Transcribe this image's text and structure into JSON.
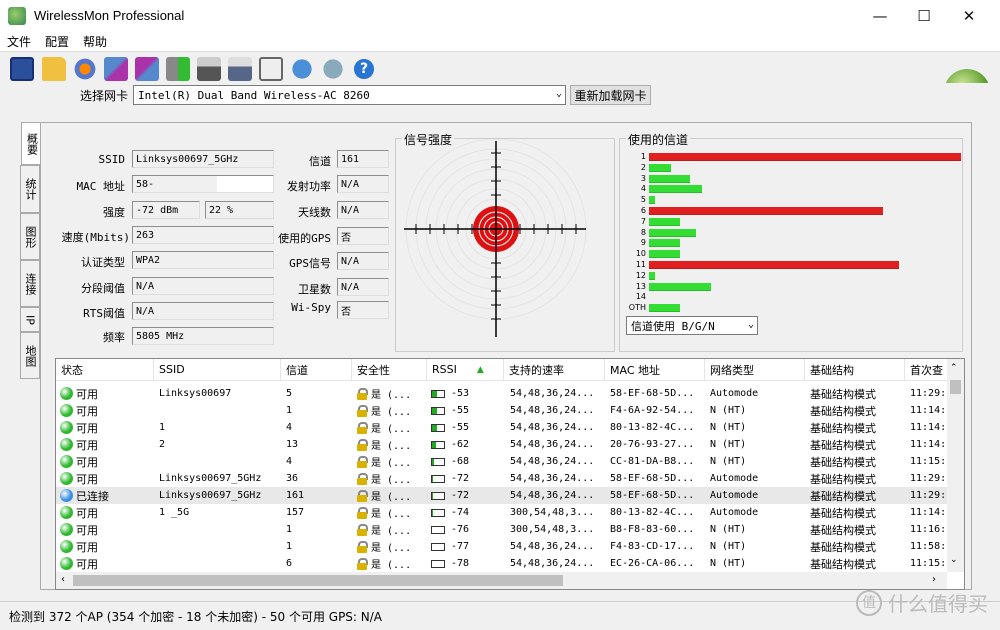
{
  "window": {
    "title": "WirelessMon Professional"
  },
  "menu": [
    "文件",
    "配置",
    "帮助"
  ],
  "toolbar_icons": [
    "save-icon",
    "open-folder-icon",
    "record-icon",
    "network-icon",
    "network-alt-icon",
    "play-icon",
    "print-icon",
    "printer-check-icon",
    "clipboard-icon",
    "globe-icon",
    "chat-icon",
    "help-icon"
  ],
  "nic": {
    "label": "选择网卡",
    "value": "Intel(R) Dual Band Wireless-AC 8260",
    "reload": "重新加载网卡"
  },
  "tabs": [
    "概要",
    "统计",
    "图形",
    "连接",
    "IP",
    "地图"
  ],
  "summary": {
    "ssid": {
      "label": "SSID",
      "value": "Linksys00697_5GHz"
    },
    "mac": {
      "label": "MAC 地址",
      "value": "58-"
    },
    "strength": {
      "label": "强度",
      "value": "-72 dBm",
      "pct": "22 %"
    },
    "speed": {
      "label": "速度(Mbits)",
      "value": "263"
    },
    "auth": {
      "label": "认证类型",
      "value": "WPA2"
    },
    "frag": {
      "label": "分段阈值",
      "value": "N/A"
    },
    "rts": {
      "label": "RTS阈值",
      "value": "N/A"
    },
    "freq": {
      "label": "频率",
      "value": "5805 MHz"
    },
    "channel": {
      "label": "信道",
      "value": "161"
    },
    "txpower": {
      "label": "发射功率",
      "value": "N/A"
    },
    "antenna": {
      "label": "天线数",
      "value": "N/A"
    },
    "gps_used": {
      "label": "使用的GPS",
      "value": "否"
    },
    "gps_signal": {
      "label": "GPS信号",
      "value": "N/A"
    },
    "satellites": {
      "label": "卫星数",
      "value": "N/A"
    },
    "wispy": {
      "label": "Wi-Spy",
      "value": "否"
    }
  },
  "signal": {
    "title": "信号强度"
  },
  "channels": {
    "title": "使用的信道",
    "labels": [
      "1",
      "2",
      "3",
      "4",
      "5",
      "6",
      "7",
      "8",
      "9",
      "10",
      "11",
      "12",
      "13",
      "14",
      "OTH"
    ],
    "levels": [
      1.0,
      0.07,
      0.13,
      0.17,
      0.02,
      0.75,
      0.1,
      0.15,
      0.1,
      0.1,
      0.8,
      0.02,
      0.2,
      0,
      0.1
    ],
    "hot": [
      true,
      false,
      false,
      false,
      false,
      true,
      false,
      false,
      false,
      false,
      true,
      false,
      false,
      false,
      false
    ],
    "select": "信道使用 B/G/N"
  },
  "colors": {
    "hot": "#e02020",
    "normal": "#33dd33",
    "ok_dot": "#2eb82e",
    "connected_dot": "#3a8fe0"
  },
  "table": {
    "headers": [
      "状态",
      "SSID",
      "信道",
      "安全性",
      "RSSI",
      "支持的速率",
      "MAC 地址",
      "网络类型",
      "基础结构",
      "首次查"
    ],
    "rows": [
      {
        "status": "可用",
        "connected": false,
        "ssid": "Linksys00697",
        "ch": "5",
        "sec": "是 (...",
        "rssi": "-53",
        "sig": 0.45,
        "rates": "54,48,36,24...",
        "mac": "58-EF-68-5D...",
        "type": "Automode",
        "infra": "基础结构模式",
        "first": "11:29:"
      },
      {
        "status": "可用",
        "connected": false,
        "ssid": "",
        "ch": "1",
        "sec": "是 (...",
        "rssi": "-55",
        "sig": 0.4,
        "rates": "54,48,36,24...",
        "mac": "F4-6A-92-54...",
        "type": "N (HT)",
        "infra": "基础结构模式",
        "first": "11:14:"
      },
      {
        "status": "可用",
        "connected": false,
        "ssid": "1",
        "ch": "4",
        "sec": "是 (...",
        "rssi": "-55",
        "sig": 0.4,
        "rates": "54,48,36,24...",
        "mac": "80-13-82-4C...",
        "type": "N (HT)",
        "infra": "基础结构模式",
        "first": "11:14:"
      },
      {
        "status": "可用",
        "connected": false,
        "ssid": "2",
        "ch": "13",
        "sec": "是 (...",
        "rssi": "-62",
        "sig": 0.3,
        "rates": "54,48,36,24...",
        "mac": "20-76-93-27...",
        "type": "N (HT)",
        "infra": "基础结构模式",
        "first": "11:14:"
      },
      {
        "status": "可用",
        "connected": false,
        "ssid": "",
        "ch": "4",
        "sec": "是 (...",
        "rssi": "-68",
        "sig": 0.2,
        "rates": "54,48,36,24...",
        "mac": "CC-81-DA-B8...",
        "type": "N (HT)",
        "infra": "基础结构模式",
        "first": "11:15:"
      },
      {
        "status": "可用",
        "connected": false,
        "ssid": "Linksys00697_5GHz",
        "ch": "36",
        "sec": "是 (...",
        "rssi": "-72",
        "sig": 0.12,
        "rates": "54,48,36,24...",
        "mac": "58-EF-68-5D...",
        "type": "Automode",
        "infra": "基础结构模式",
        "first": "11:29:"
      },
      {
        "status": "已连接",
        "connected": true,
        "ssid": "Linksys00697_5GHz",
        "ch": "161",
        "sec": "是 (...",
        "rssi": "-72",
        "sig": 0.12,
        "rates": "54,48,36,24...",
        "mac": "58-EF-68-5D...",
        "type": "Automode",
        "infra": "基础结构模式",
        "first": "11:29:"
      },
      {
        "status": "可用",
        "connected": false,
        "ssid": "1 _5G",
        "ch": "157",
        "sec": "是 (...",
        "rssi": "-74",
        "sig": 0.1,
        "rates": "300,54,48,3...",
        "mac": "80-13-82-4C...",
        "type": "Automode",
        "infra": "基础结构模式",
        "first": "11:14:"
      },
      {
        "status": "可用",
        "connected": false,
        "ssid": "",
        "ch": "1",
        "sec": "是 (...",
        "rssi": "-76",
        "sig": 0,
        "rates": "300,54,48,3...",
        "mac": "B8-F8-83-60...",
        "type": "N (HT)",
        "infra": "基础结构模式",
        "first": "11:16:"
      },
      {
        "status": "可用",
        "connected": false,
        "ssid": "",
        "ch": "1",
        "sec": "是 (...",
        "rssi": "-77",
        "sig": 0,
        "rates": "54,48,36,24...",
        "mac": "F4-83-CD-17...",
        "type": "N (HT)",
        "infra": "基础结构模式",
        "first": "11:58:"
      },
      {
        "status": "可用",
        "connected": false,
        "ssid": "",
        "ch": "6",
        "sec": "是 (...",
        "rssi": "-78",
        "sig": 0,
        "rates": "54,48,36,24...",
        "mac": "EC-26-CA-06...",
        "type": "N (HT)",
        "infra": "基础结构模式",
        "first": "11:15:"
      }
    ]
  },
  "statusbar": "检测到 372 个AP (354 个加密 - 18 个未加密) - 50 个可用 GPS: N/A",
  "watermark": "什么值得买"
}
